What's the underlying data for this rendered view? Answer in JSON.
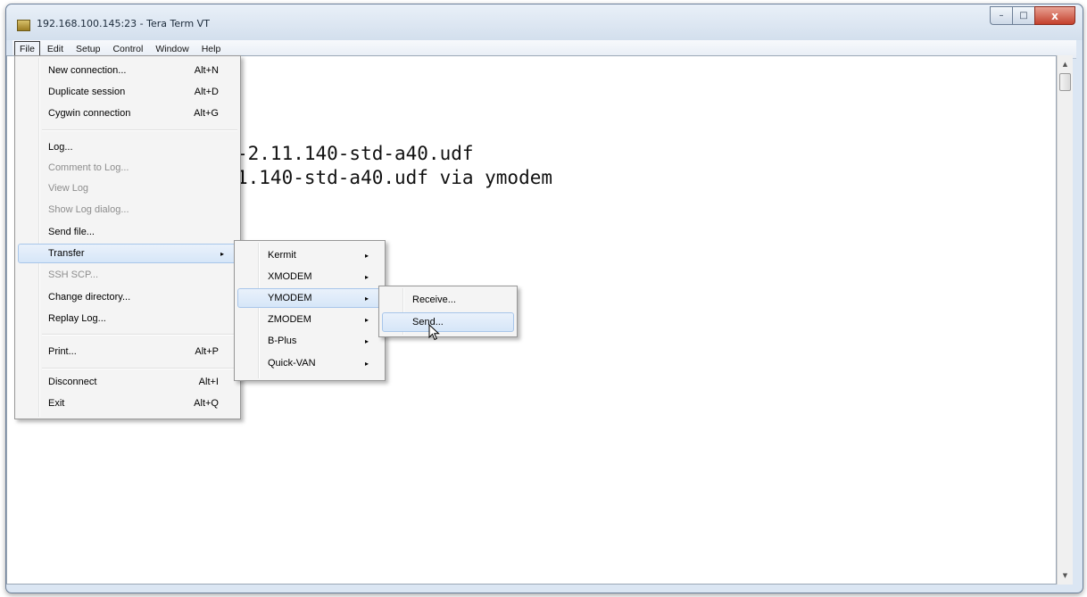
{
  "window": {
    "title": "192.168.100.145:23 - Tera Term VT",
    "controls": {
      "minimize": "–",
      "maximize": "□",
      "close": "x"
    }
  },
  "menubar": [
    "File",
    "Edit",
    "Setup",
    "Control",
    "Window",
    "Help"
  ],
  "terminal": {
    "lines": [
      "-2.11.140-std-a40.udf",
      "1.140-std-a40.udf via ymodem"
    ]
  },
  "file_menu": {
    "items": [
      {
        "label": "New connection...",
        "accel": "Alt+N"
      },
      {
        "label": "Duplicate session",
        "accel": "Alt+D"
      },
      {
        "label": "Cygwin connection",
        "accel": "Alt+G"
      },
      {
        "label": "Log...",
        "accel": ""
      },
      {
        "label": "Comment to Log...",
        "accel": "",
        "disabled": true
      },
      {
        "label": "View Log",
        "accel": "",
        "disabled": true
      },
      {
        "label": "Show Log dialog...",
        "accel": "",
        "disabled": true
      },
      {
        "label": "Send file...",
        "accel": ""
      },
      {
        "label": "Transfer",
        "accel": "",
        "submenu": true,
        "highlighted": true
      },
      {
        "label": "SSH SCP...",
        "accel": "",
        "disabled": true
      },
      {
        "label": "Change directory...",
        "accel": ""
      },
      {
        "label": "Replay Log...",
        "accel": ""
      },
      {
        "label": "Print...",
        "accel": "Alt+P"
      },
      {
        "label": "Disconnect",
        "accel": "Alt+I"
      },
      {
        "label": "Exit",
        "accel": "Alt+Q"
      }
    ]
  },
  "transfer_menu": {
    "items": [
      {
        "label": "Kermit"
      },
      {
        "label": "XMODEM"
      },
      {
        "label": "YMODEM",
        "highlighted": true
      },
      {
        "label": "ZMODEM"
      },
      {
        "label": "B-Plus"
      },
      {
        "label": "Quick-VAN"
      }
    ]
  },
  "ymodem_menu": {
    "items": [
      {
        "label": "Receive..."
      },
      {
        "label": "Send...",
        "highlighted": true
      }
    ]
  },
  "icons": {
    "submenu_arrow": "▸",
    "scroll_up": "▲",
    "scroll_down": "▼"
  }
}
